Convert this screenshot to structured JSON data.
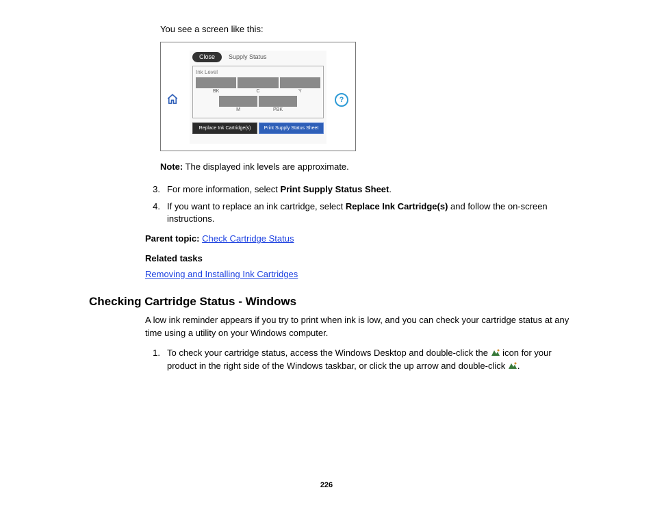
{
  "intro": "You see a screen like this:",
  "lcd": {
    "close": "Close",
    "title": "Supply Status",
    "ink_label": "Ink Level",
    "row1_labels": [
      "BK",
      "C",
      "Y"
    ],
    "row2_labels": [
      "M",
      "PBK"
    ],
    "btn_replace": "Replace Ink Cartridge(s)",
    "btn_print": "Print Supply Status Sheet"
  },
  "note_label": "Note:",
  "note_text": " The displayed ink levels are approximate.",
  "steps": {
    "s3_num": "3.",
    "s3_a": "For more information, select ",
    "s3_b": "Print Supply Status Sheet",
    "s3_c": ".",
    "s4_num": "4.",
    "s4_a": "If you want to replace an ink cartridge, select ",
    "s4_b": "Replace Ink Cartridge(s)",
    "s4_c": " and follow the on-screen instructions."
  },
  "parent_label": "Parent topic:",
  "parent_link": "Check Cartridge Status",
  "related_label": "Related tasks",
  "related_link": "Removing and Installing Ink Cartridges",
  "section_heading": "Checking Cartridge Status - Windows",
  "section_intro": "A low ink reminder appears if you try to print when ink is low, and you can check your cartridge status at any time using a utility on your Windows computer.",
  "win": {
    "num": "1.",
    "a": "To check your cartridge status, access the Windows Desktop and double-click the ",
    "b": " icon for your product in the right side of the Windows taskbar, or click the up arrow and double-click ",
    "c": "."
  },
  "page_number": "226"
}
